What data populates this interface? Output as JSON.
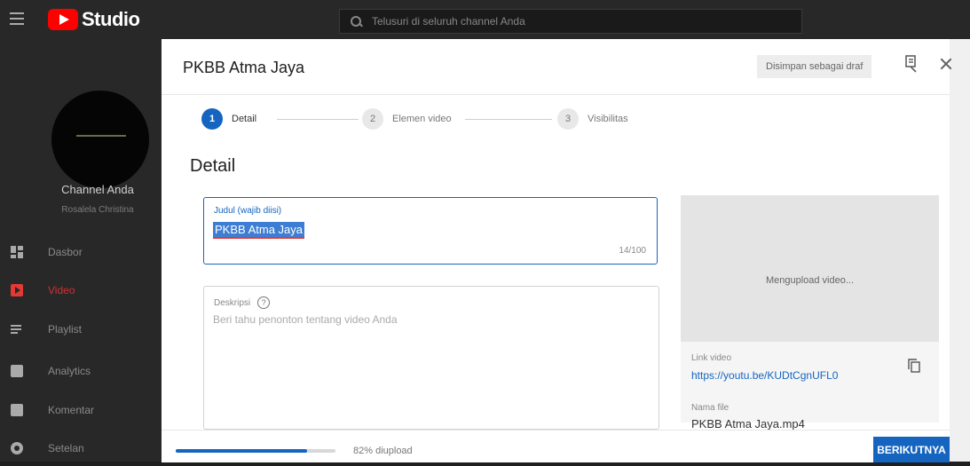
{
  "app": {
    "logo_text": "Studio"
  },
  "search": {
    "placeholder": "Telusuri di seluruh channel Anda"
  },
  "sidebar": {
    "channel_title": "Channel Anda",
    "channel_name": "Rosalela Christina",
    "items": [
      {
        "label": "Dasbor",
        "icon": "dashboard-icon"
      },
      {
        "label": "Video",
        "icon": "video-icon",
        "active": true
      },
      {
        "label": "Playlist",
        "icon": "playlist-icon"
      },
      {
        "label": "Analytics",
        "icon": "analytics-icon"
      },
      {
        "label": "Komentar",
        "icon": "comment-icon"
      },
      {
        "label": "Setelan",
        "icon": "settings-icon"
      }
    ]
  },
  "modal": {
    "title": "PKBB Atma Jaya",
    "draft_status": "Disimpan sebagai draf",
    "steps": [
      {
        "number": "1",
        "label": "Detail",
        "active": true
      },
      {
        "number": "2",
        "label": "Elemen video"
      },
      {
        "number": "3",
        "label": "Visibilitas"
      }
    ],
    "section_heading": "Detail",
    "title_field": {
      "label": "Judul (wajib diisi)",
      "value": "PKBB Atma Jaya",
      "counter": "14/100"
    },
    "description_field": {
      "label": "Deskripsi",
      "placeholder": "Beri tahu penonton tentang video Anda"
    },
    "preview": {
      "status": "Mengupload video...",
      "link_label": "Link video",
      "link_url": "https://youtu.be/KUDtCgnUFL0",
      "file_label": "Nama file",
      "file_name": "PKBB Atma Jaya.mp4"
    },
    "footer": {
      "progress_text": "82% diupload",
      "progress": 0.82,
      "next_label": "BERIKUTNYA"
    }
  },
  "colors": {
    "accent": "#1565c0",
    "brand": "#ff0000",
    "active_nav": "#d32f2f"
  }
}
